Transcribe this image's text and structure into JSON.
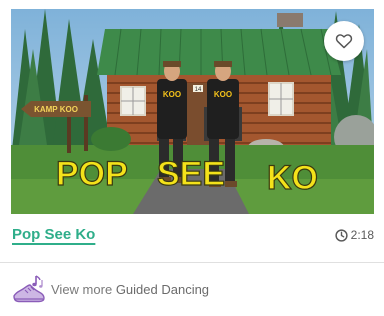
{
  "video": {
    "title": "Pop See Ko",
    "duration": "2:18",
    "thumbnail": {
      "overlay_text": [
        "POP",
        "SEE",
        "KO"
      ],
      "sign_text": "KAMP KOO",
      "shirt_text": "KOO",
      "cabin_number": "14"
    }
  },
  "more_link": {
    "prefix": "View more",
    "category": "Guided Dancing"
  },
  "colors": {
    "accent": "#2fae8a",
    "caption_yellow": "#f4e21a",
    "muted_text": "#7a7a7a"
  },
  "icons": {
    "favorite": "heart-outline-icon",
    "duration": "clock-icon",
    "category": "dance-shoe-icon"
  }
}
